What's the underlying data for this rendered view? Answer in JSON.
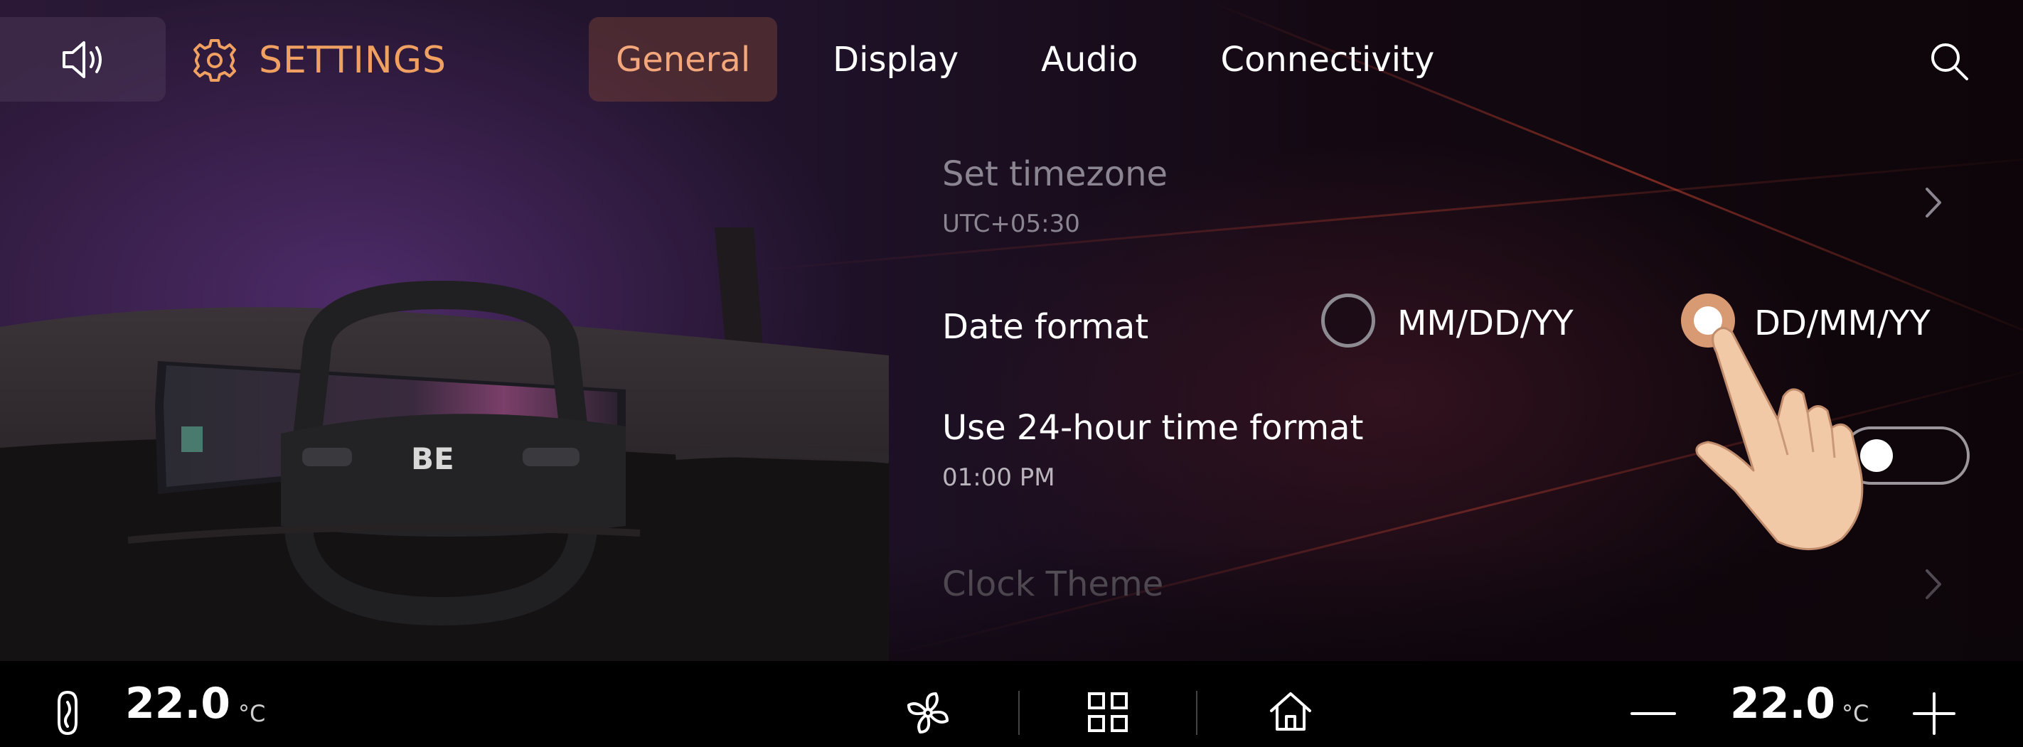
{
  "header": {
    "title": "SETTINGS",
    "tabs": [
      {
        "label": "General",
        "active": true
      },
      {
        "label": "Display",
        "active": false
      },
      {
        "label": "Audio",
        "active": false
      },
      {
        "label": "Connectivity",
        "active": false
      }
    ]
  },
  "vehicle_display": {
    "logo": "BE"
  },
  "settings": {
    "timezone": {
      "label": "Set timezone",
      "value": "UTC+05:30"
    },
    "date_format": {
      "label": "Date format",
      "options": [
        {
          "label": "MM/DD/YY",
          "selected": false
        },
        {
          "label": "DD/MM/YY",
          "selected": true
        }
      ]
    },
    "time_format": {
      "label": "Use 24-hour time format",
      "value": "01:00 PM",
      "enabled": false
    },
    "clock_theme": {
      "label": "Clock Theme"
    }
  },
  "climate": {
    "left_temp": "22.0",
    "right_temp": "22.0",
    "unit": "°C"
  },
  "icons": [
    "speaker-icon",
    "gear-icon",
    "search-icon",
    "chevron-right-icon",
    "seat-heat-icon",
    "fan-icon",
    "apps-grid-icon",
    "home-icon",
    "minus-icon",
    "plus-icon",
    "hand-pointer-icon"
  ],
  "colors": {
    "accent": "#F0A060",
    "active_tab_bg": "#5A302E",
    "radio_selected": "#D79A73"
  }
}
